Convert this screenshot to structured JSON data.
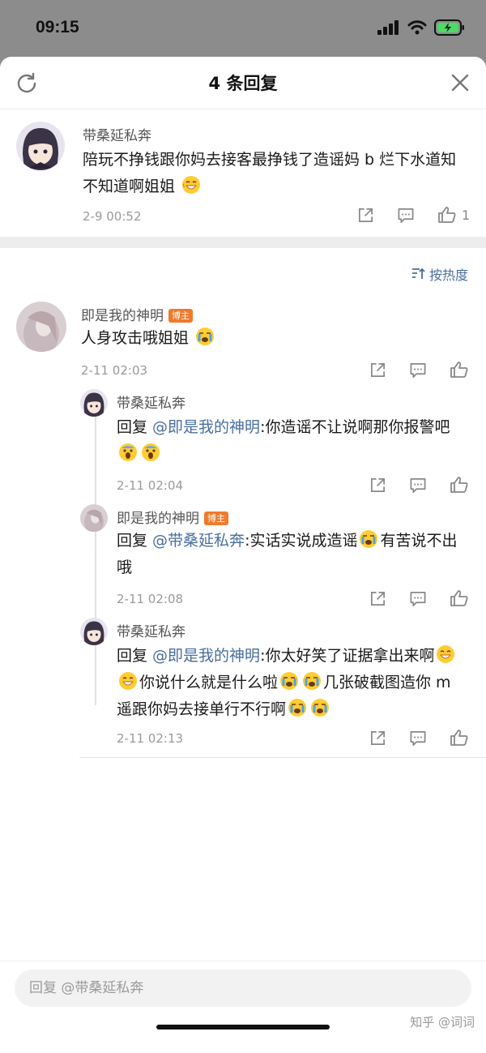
{
  "status_bar": {
    "time": "09:15"
  },
  "header": {
    "title": "4 条回复"
  },
  "root_comment": {
    "author": "带桑延私奔",
    "text": "陪玩不挣钱跟你妈去接客最挣钱了造谣妈 b 烂下水道知不知道啊姐姐",
    "date": "2-9 00:52",
    "likes": "1"
  },
  "sort": {
    "label": "按热度"
  },
  "replies": [
    {
      "author": "即是我的神明",
      "badge": "博主",
      "text": "人身攻击哦姐姐",
      "date": "2-11 02:03"
    },
    {
      "author": "带桑延私奔",
      "prefix": "回复 ",
      "mention": "@即是我的神明",
      "text": ":你造谣不让说啊那你报警吧",
      "date": "2-11 02:04"
    },
    {
      "author": "即是我的神明",
      "badge": "博主",
      "prefix": "回复 ",
      "mention": "@带桑延私奔",
      "text": ":实话实说成造谣",
      "text2": "有苦说不出哦",
      "date": "2-11 02:08"
    },
    {
      "author": "带桑延私奔",
      "prefix": "回复 ",
      "mention": "@即是我的神明",
      "text": ":你太好笑了证据拿出来啊",
      "text2": "你说什么就是什么啦",
      "text3": "几张破截图造你 m 遥跟你妈去接单行不行啊",
      "date": "2-11 02:13"
    }
  ],
  "input": {
    "placeholder": "回复 @带桑延私奔"
  },
  "watermark": "知乎 @词词",
  "colors": {
    "link": "#4a6e9e",
    "badge": "#f07a2c",
    "divider": "#ededed"
  }
}
